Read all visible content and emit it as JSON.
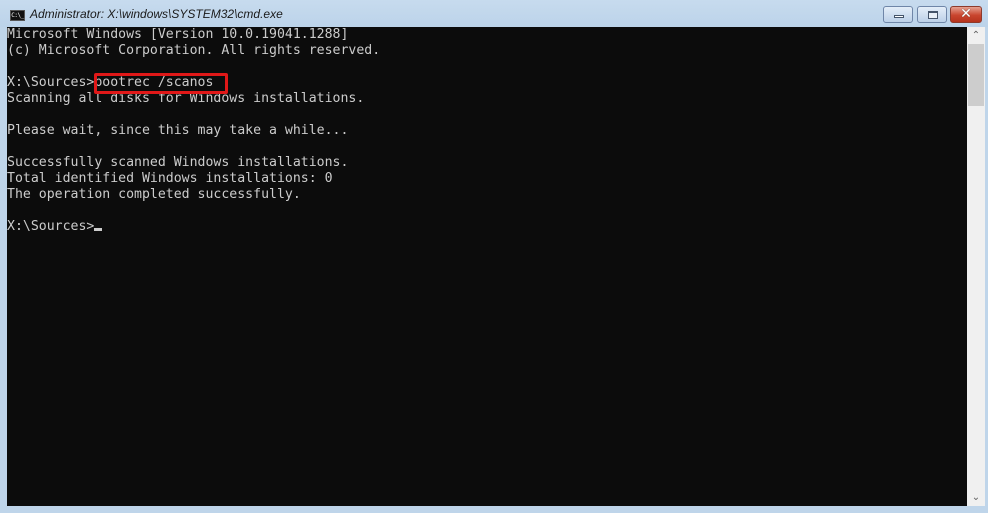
{
  "window": {
    "title": "Administrator: X:\\windows\\SYSTEM32\\cmd.exe",
    "icon": "cmd-icon",
    "icon_text": "C:\\_",
    "controls": {
      "minimize": "minimize-icon",
      "maximize": "maximize-icon",
      "close_glyph": "✕"
    }
  },
  "console": {
    "lines": [
      "Microsoft Windows [Version 10.0.19041.1288]",
      "(c) Microsoft Corporation. All rights reserved.",
      "",
      "X:\\Sources>bootrec /scanos",
      "Scanning all disks for Windows installations.",
      "",
      "Please wait, since this may take a while...",
      "",
      "Successfully scanned Windows installations.",
      "Total identified Windows installations: 0",
      "The operation completed successfully.",
      "",
      "X:\\Sources>"
    ],
    "highlighted_command": "bootrec /scanos",
    "highlight_color": "#e01818",
    "text_color": "#cccccc",
    "background_color": "#0c0c0c"
  },
  "scrollbar": {
    "up_glyph": "⌃",
    "down_glyph": "⌄"
  }
}
